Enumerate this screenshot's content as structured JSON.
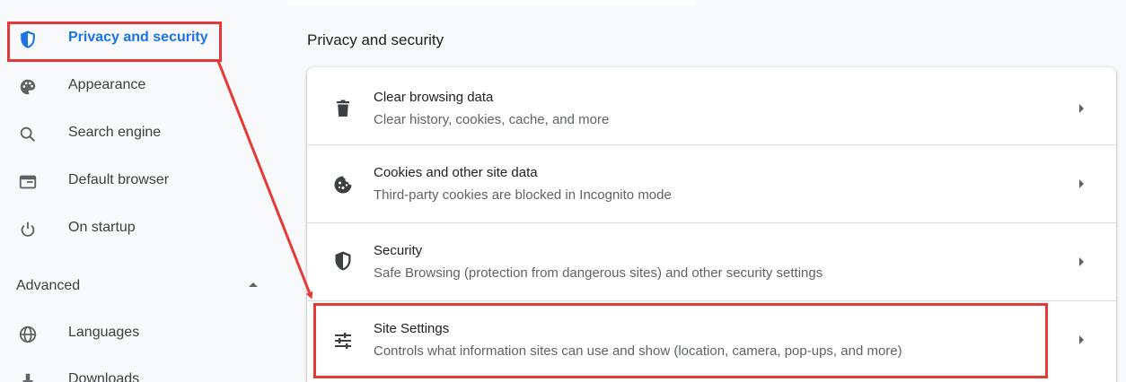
{
  "sidebar": {
    "items": [
      {
        "label": "Privacy and security",
        "icon": "shield-icon",
        "active": true
      },
      {
        "label": "Appearance",
        "icon": "palette-icon"
      },
      {
        "label": "Search engine",
        "icon": "search-icon"
      },
      {
        "label": "Default browser",
        "icon": "browser-window-icon"
      },
      {
        "label": "On startup",
        "icon": "power-icon"
      }
    ],
    "advanced": {
      "label": "Advanced",
      "icon": "caret-up-icon"
    },
    "advanced_items": [
      {
        "label": "Languages",
        "icon": "globe-icon"
      },
      {
        "label": "Downloads",
        "icon": "download-icon"
      }
    ]
  },
  "main": {
    "section_title": "Privacy and security",
    "rows": [
      {
        "title": "Clear browsing data",
        "subtitle": "Clear history, cookies, cache, and more",
        "icon": "trash-icon"
      },
      {
        "title": "Cookies and other site data",
        "subtitle": "Third-party cookies are blocked in Incognito mode",
        "icon": "cookie-icon"
      },
      {
        "title": "Security",
        "subtitle": "Safe Browsing (protection from dangerous sites) and other security settings",
        "icon": "shield-icon"
      },
      {
        "title": "Site Settings",
        "subtitle": "Controls what information sites can use and show (location, camera, pop-ups, and more)",
        "icon": "tune-icon"
      }
    ]
  },
  "colors": {
    "accent": "#1a73e8",
    "annotation": "#e53935",
    "text_primary": "#202124",
    "text_secondary": "#5f6368"
  }
}
